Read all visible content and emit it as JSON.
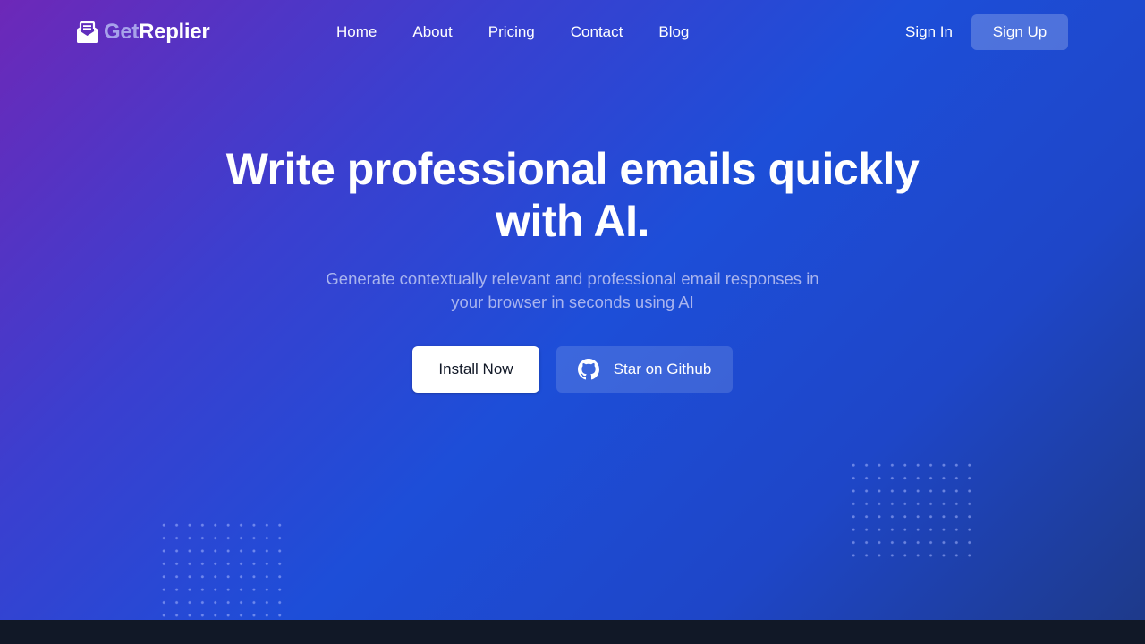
{
  "brand": {
    "prefix": "Get",
    "name": "Replier",
    "icon": "envelope-icon"
  },
  "nav": {
    "links": [
      "Home",
      "About",
      "Pricing",
      "Contact",
      "Blog"
    ]
  },
  "auth": {
    "sign_in": "Sign In",
    "sign_up": "Sign Up"
  },
  "hero": {
    "title_line1": "Write professional emails quickly",
    "title_line2": "with AI.",
    "subtitle_line1": "Generate contextually relevant and professional email responses in",
    "subtitle_line2": "your browser in seconds using AI",
    "primary_cta": "Install Now",
    "secondary_cta": "Star on Github",
    "secondary_icon": "github-icon"
  },
  "colors": {
    "gradient_start": "#6d28b8",
    "gradient_mid": "#1d4ed8",
    "gradient_end": "#1e3a8a",
    "footer_bg": "#111827",
    "brand_prefix": "#a7a2ea",
    "subtitle": "#a9b4ee"
  }
}
